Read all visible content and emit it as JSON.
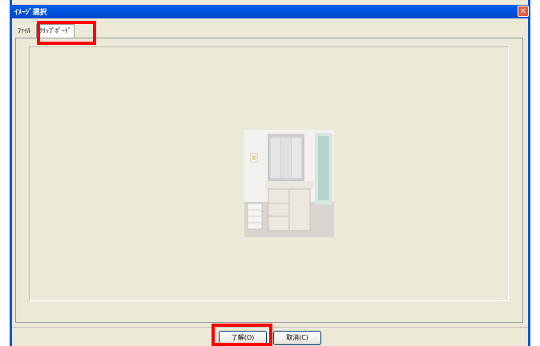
{
  "window": {
    "title": "ｲﾒｰｼﾞ選択",
    "close_label": "✕"
  },
  "tabs": [
    {
      "label": "ﾌｧｲﾙ",
      "active": false
    },
    {
      "label": "ｸﾘｯﾌﾟﾎﾞｰﾄﾞ",
      "active": true
    }
  ],
  "buttons": {
    "ok_label": "了解(O)",
    "cancel_label": "取消(C)"
  },
  "colors": {
    "titlebar": "#0054e3",
    "dialog_bg": "#ece9d8",
    "highlight": "#ff0000"
  }
}
